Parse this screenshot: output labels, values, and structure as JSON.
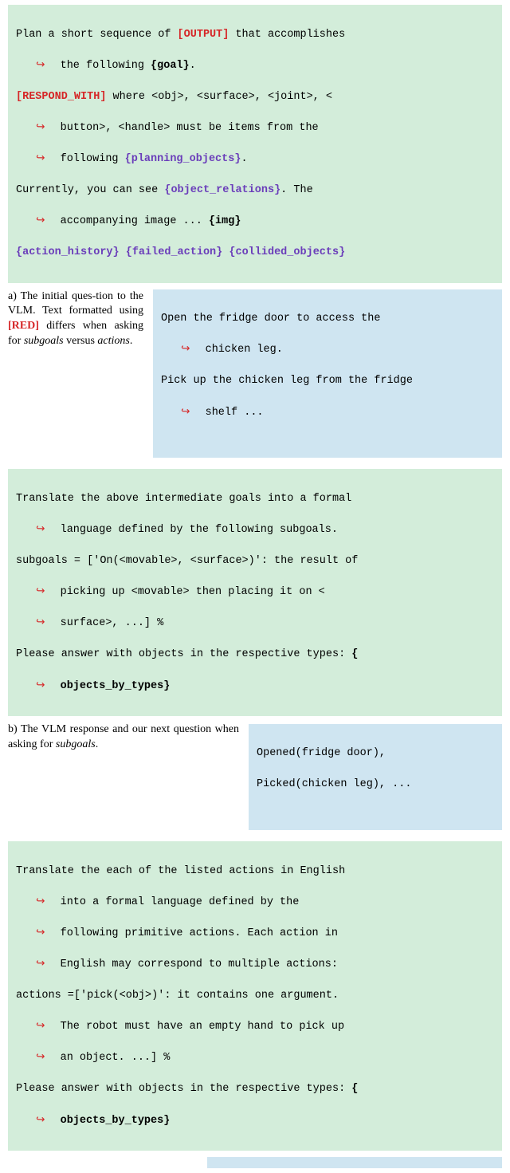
{
  "block1": {
    "l1a": "Plan a short sequence of ",
    "l1_out": "[OUTPUT]",
    "l1b": " that accomplishes",
    "l2a": "the following ",
    "l2_goal": "{goal}",
    "l2b": ".",
    "l3_resp": "[RESPOND_WITH]",
    "l3a": " where <obj>, <surface>, <joint>, <",
    "l4a": "button>, <handle> must be items from the",
    "l5a": "following ",
    "l5_plan": "{planning_objects}",
    "l5b": ".",
    "l6a": "Currently, you can see ",
    "l6_obj": "{object_relations}",
    "l6b": ". The",
    "l7a": "accompanying image ... ",
    "l7_img": "{img}",
    "l8_ah": "{action_history}",
    "l8_fa": "{failed_action}",
    "l8_co": "{collided_objects}"
  },
  "caption_a": {
    "t1": "a) The initial ques-tion to the VLM. Text formatted using ",
    "t_red": "[RED]",
    "t2": " differs when asking for ",
    "t_sub": "subgoals",
    "t3": " versus ",
    "t_act": "actions",
    "t4": "."
  },
  "resp_a": {
    "l1": "Open the fridge door to access the",
    "l2": "chicken leg.",
    "l3": "Pick up the chicken leg from the fridge",
    "l4": "shelf ..."
  },
  "block3": {
    "l1": "Translate the above intermediate goals into a formal",
    "l2": "language defined by the following subgoals.",
    "l3": "subgoals = ['On(<movable>, <surface>)': the result of",
    "l4": " picking up <movable> then placing it on <",
    "l5": "surface>, ...] %",
    "l6a": "Please answer with objects in the respective types: ",
    "l6_pf": "{",
    "l7_obj": "objects_by_types}"
  },
  "caption_b": {
    "t1": "b) The VLM response and our next question when asking for ",
    "t_sub": "subgoals",
    "t2": "."
  },
  "resp_b": {
    "l1": "Opened(fridge door),",
    "l2": "Picked(chicken leg), ..."
  },
  "block5": {
    "l1": "Translate the each of the listed actions in English",
    "l2": "into a formal language defined by the",
    "l3": "following primitive actions. Each action in",
    "l4": "English may correspond to multiple actions:",
    "l5": "actions =['pick(<obj>)': it contains one argument.",
    "l6": "The robot must have an empty hand to pick up",
    "l7": "an object. ...] %",
    "l8a": "Please answer with objects in the respective types: ",
    "l8_pf": "{",
    "l9_obj": "objects_by_types}"
  }
}
